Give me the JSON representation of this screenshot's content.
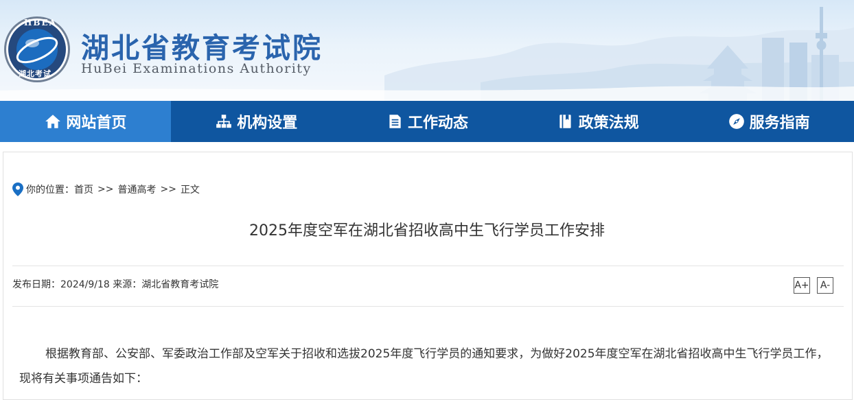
{
  "header": {
    "emblem_text": "HBEA",
    "emblem_subtext": "湖北考试",
    "title": "湖北省教育考试院",
    "subtitle": "HuBei Examinations Authority"
  },
  "nav": {
    "items": [
      {
        "label": "网站首页",
        "icon": "home-icon",
        "active": true
      },
      {
        "label": "机构设置",
        "icon": "org-chart-icon",
        "active": false
      },
      {
        "label": "工作动态",
        "icon": "document-icon",
        "active": false
      },
      {
        "label": "政策法规",
        "icon": "book-icon",
        "active": false
      },
      {
        "label": "服务指南",
        "icon": "compass-icon",
        "active": false
      }
    ]
  },
  "breadcrumb": {
    "prefix": "你的位置：",
    "items": [
      "首页",
      "普通高考",
      "正文"
    ],
    "separator": ">>"
  },
  "article": {
    "title": "2025年度空军在湖北省招收高中生飞行学员工作安排",
    "meta": "发布日期：2024/9/18 来源：湖北省教育考试院",
    "font_increase_label": "A+",
    "font_decrease_label": "A-",
    "paragraph": "根据教育部、公安部、军委政治工作部及空军关于招收和选拔2025年度飞行学员的通知要求，为做好2025年度空军在湖北省招收高中生飞行学员工作，现将有关事项通告如下："
  },
  "colors": {
    "nav_bg": "#0f56a0",
    "nav_active_bg": "#2d7fd0",
    "title_blue": "#2a64ad",
    "pin_blue": "#1a6fc4"
  }
}
